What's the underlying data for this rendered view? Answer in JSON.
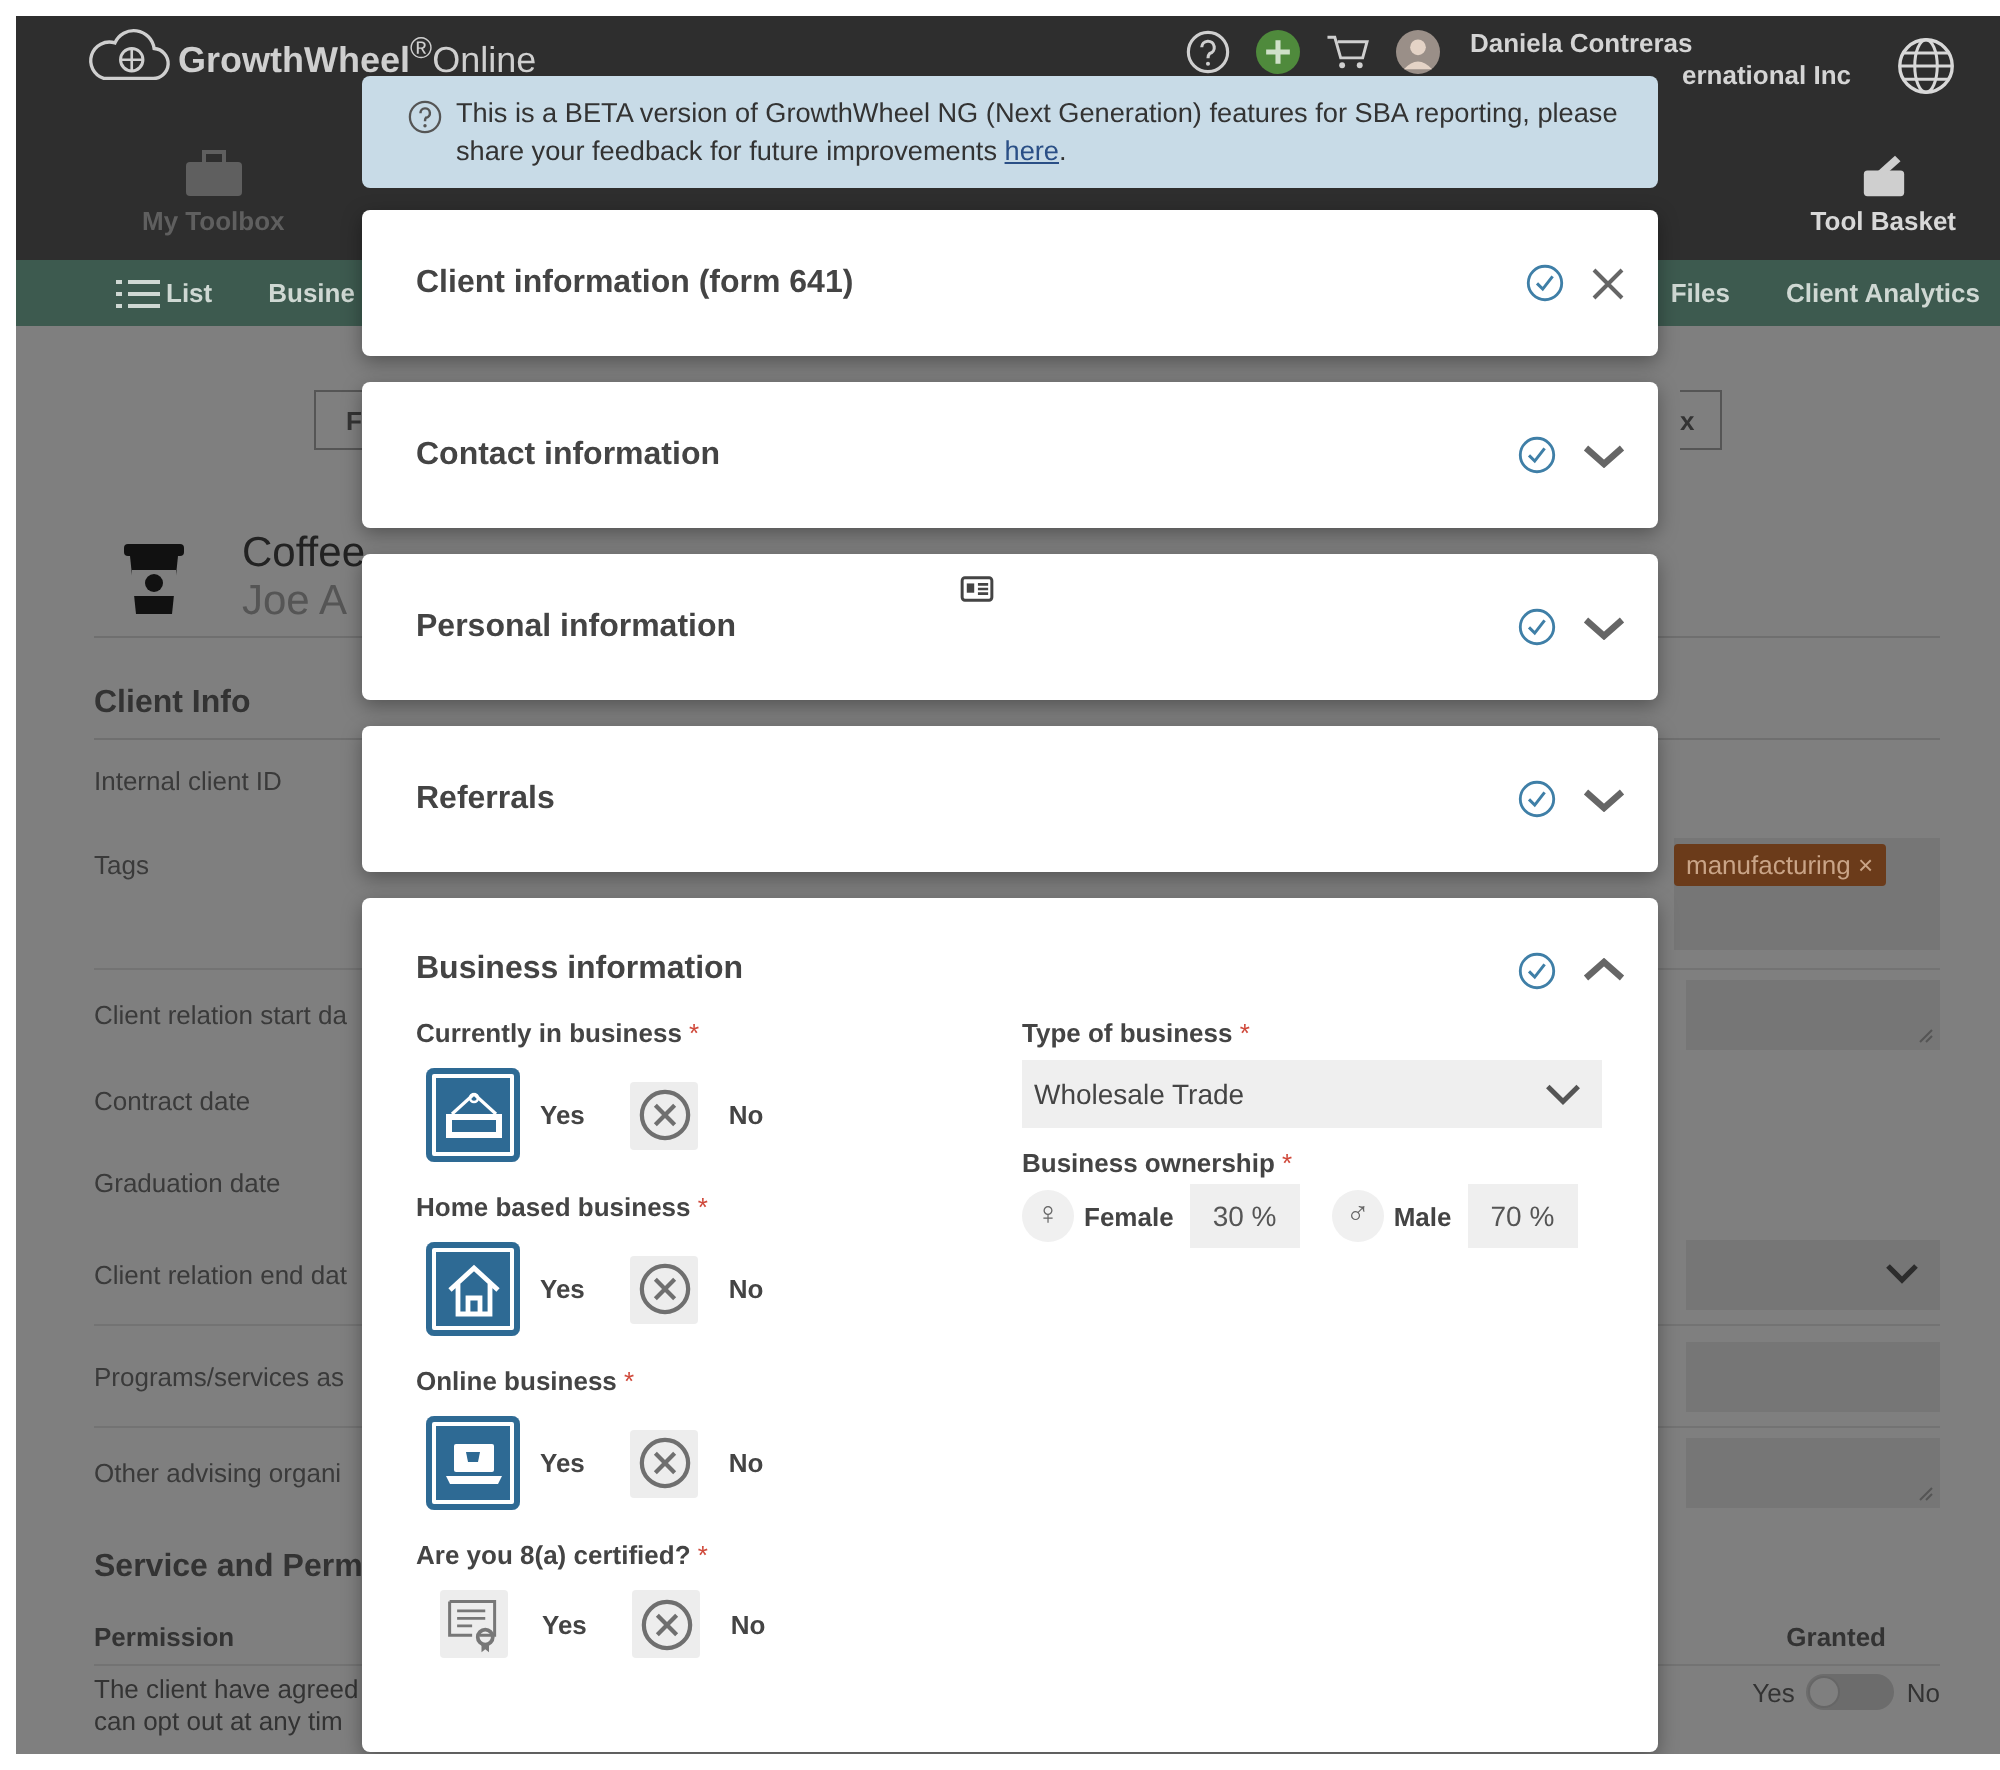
{
  "header": {
    "brand": "**GrowthWheel**$^{®}$Online",
    "user_name": "Daniela Contreras",
    "user_org": "ernational Inc",
    "toolbar": [
      {
        "label": "My Toolbox"
      },
      {
        "label": "Tool Basket"
      }
    ]
  },
  "nav": {
    "left": [
      {
        "label": "List"
      },
      {
        "label": "Busine"
      }
    ],
    "right": [
      {
        "label": "Files"
      },
      {
        "label": "Client Analytics"
      }
    ]
  },
  "page": {
    "action_buttons": [
      "F",
      "x"
    ],
    "client": {
      "title": "Coffee",
      "subtitle": "Joe A"
    },
    "section": "Client Info",
    "rows": [
      {
        "label": "Internal client ID",
        "kind": "plain"
      },
      {
        "label": "Tags",
        "kind": "tags",
        "tags": [
          {
            "label": "manufacturing",
            "remove": "×"
          }
        ]
      },
      {
        "label": "Client relation start da",
        "kind": "textarea"
      },
      {
        "label": "Contract date",
        "kind": "plain"
      },
      {
        "label": "Graduation date",
        "kind": "plain"
      },
      {
        "label": "Client relation end dat",
        "kind": "select"
      },
      {
        "label": "Programs/services as",
        "kind": "input"
      },
      {
        "label": "Other advising organi",
        "kind": "textarea"
      }
    ],
    "section2": "Service and Perm",
    "permission_header": "Permission",
    "granted_header": "Granted",
    "permission": {
      "lines": [
        "The client have agreed",
        "can opt out at any tim"
      ],
      "yes": "Yes",
      "no": "No",
      "on": false
    }
  },
  "modal": {
    "banner": {
      "text": "This is a BETA version of GrowthWheel NG (Next Generation) features for SBA reporting, please share your feedback for future improvements ",
      "link": "here",
      "end": "."
    },
    "panels": [
      {
        "title": "Client information (form 641)",
        "kind": "closable",
        "complete": true,
        "card_icon": false
      },
      {
        "title": "Contact information",
        "kind": "collapsible",
        "complete": true,
        "expanded": false,
        "card_icon": false
      },
      {
        "title": "Personal information",
        "kind": "collapsible",
        "complete": true,
        "expanded": false,
        "card_icon": true
      },
      {
        "title": "Referrals",
        "kind": "collapsible",
        "complete": true,
        "expanded": false,
        "card_icon": false
      },
      {
        "title": "Business information",
        "kind": "collapsible",
        "complete": true,
        "expanded": true,
        "card_icon": false
      }
    ],
    "business": {
      "questions": [
        {
          "label": "Currently in business",
          "mark": "*",
          "options": [
            {
              "label": "Yes",
              "selected": true
            },
            {
              "label": "No",
              "selected": false
            }
          ]
        },
        {
          "label": "Home based business",
          "mark": "*",
          "options": [
            {
              "label": "Yes",
              "selected": true
            },
            {
              "label": "No",
              "selected": false
            }
          ]
        },
        {
          "label": "Online business",
          "mark": "*",
          "options": [
            {
              "label": "Yes",
              "selected": true
            },
            {
              "label": "No",
              "selected": false
            }
          ]
        },
        {
          "label": "Are you 8(a) certified?",
          "mark": "*",
          "options": [
            {
              "label": "Yes",
              "selected": false
            },
            {
              "label": "No",
              "selected": false
            }
          ]
        }
      ],
      "type": {
        "label": "Type of business",
        "mark": "*",
        "value": "Wholesale Trade"
      },
      "ownership": {
        "label": "Business ownership",
        "mark": "*",
        "owners": [
          {
            "symbol": "♀",
            "label": "Female",
            "value": "30 %"
          },
          {
            "symbol": "♂",
            "label": "Male",
            "value": "70 %"
          }
        ]
      }
    }
  }
}
